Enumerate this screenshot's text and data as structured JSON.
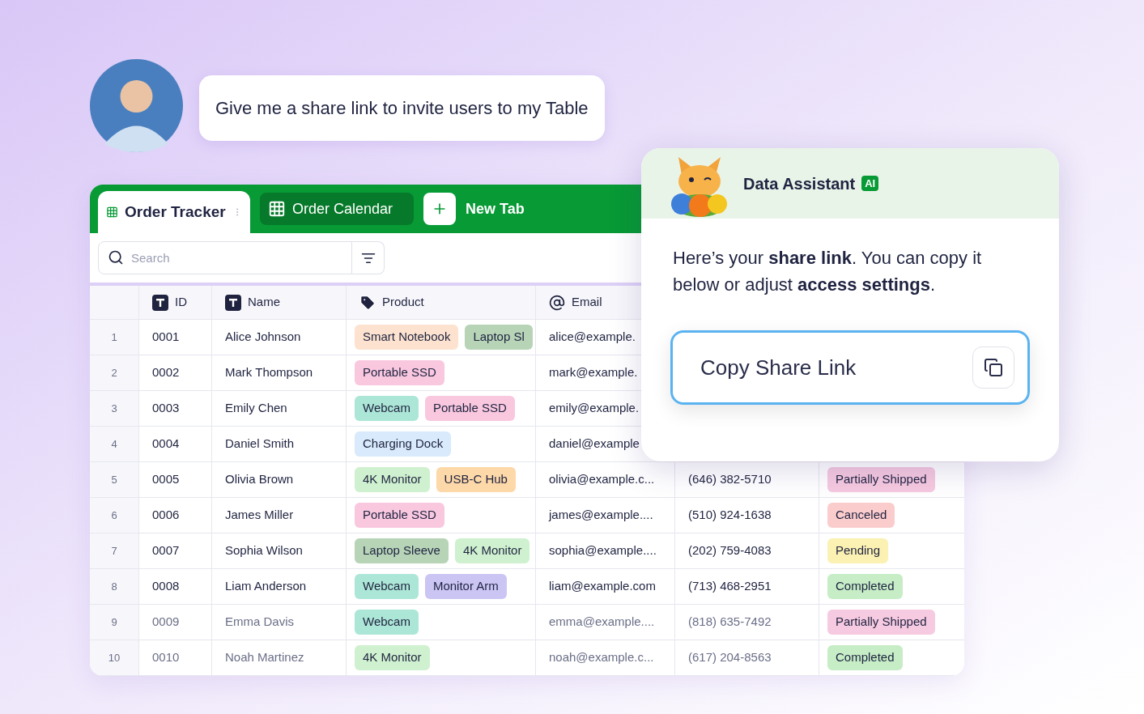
{
  "chat": {
    "message": "Give me a share link to invite users to my Table"
  },
  "tabs": [
    {
      "label": "Order Tracker",
      "selected": true
    },
    {
      "label": "Order Calendar",
      "selected": false
    }
  ],
  "new_tab": {
    "label": "New Tab"
  },
  "search": {
    "placeholder": "Search"
  },
  "table": {
    "columns": [
      {
        "label": "ID",
        "kind": "text"
      },
      {
        "label": "Name",
        "kind": "text"
      },
      {
        "label": "Product",
        "kind": "tag"
      },
      {
        "label": "Email",
        "kind": "email"
      }
    ],
    "rows": [
      {
        "number": "1",
        "id": "0001",
        "name": "Alice Johnson",
        "products": [
          {
            "label": "Smart Notebook",
            "color": "#fde3cf"
          },
          {
            "label": "Laptop Sl",
            "color": "#b7d4b7"
          }
        ],
        "email": "alice@example."
      },
      {
        "number": "2",
        "id": "0002",
        "name": "Mark Thompson",
        "products": [
          {
            "label": "Portable SSD",
            "color": "#f9c8df"
          }
        ],
        "email": "mark@example."
      },
      {
        "number": "3",
        "id": "0003",
        "name": "Emily Chen",
        "products": [
          {
            "label": "Webcam",
            "color": "#ace6d6"
          },
          {
            "label": "Portable SSD",
            "color": "#f9c8df"
          }
        ],
        "email": "emily@example."
      },
      {
        "number": "4",
        "id": "0004",
        "name": "Daniel Smith",
        "products": [
          {
            "label": "Charging Dock",
            "color": "#d8eafb"
          }
        ],
        "email": "daniel@example"
      },
      {
        "number": "5",
        "id": "0005",
        "name": "Olivia Brown",
        "products": [
          {
            "label": "4K Monitor",
            "color": "#cff1cf"
          },
          {
            "label": "USB-C Hub",
            "color": "#fdd8a8"
          }
        ],
        "email": "olivia@example.c...",
        "phone": "(646) 382-5710",
        "status": {
          "label": "Partially Shipped",
          "color": "#f6cae0"
        }
      },
      {
        "number": "6",
        "id": "0006",
        "name": "James Miller",
        "products": [
          {
            "label": "Portable SSD",
            "color": "#f9c8df"
          }
        ],
        "email": "james@example....",
        "phone": "(510) 924-1638",
        "status": {
          "label": "Canceled",
          "color": "#fbcccc"
        }
      },
      {
        "number": "7",
        "id": "0007",
        "name": "Sophia Wilson",
        "products": [
          {
            "label": "Laptop Sleeve",
            "color": "#b7d4b7"
          },
          {
            "label": "4K Monitor",
            "color": "#cff1cf"
          }
        ],
        "email": "sophia@example....",
        "phone": "(202) 759-4083",
        "status": {
          "label": "Pending",
          "color": "#fbf1b3"
        }
      },
      {
        "number": "8",
        "id": "0008",
        "name": "Liam Anderson",
        "products": [
          {
            "label": "Webcam",
            "color": "#ace6d6"
          },
          {
            "label": "Monitor Arm",
            "color": "#cbc5f4"
          }
        ],
        "email": "liam@example.com",
        "phone": "(713) 468-2951",
        "status": {
          "label": "Completed",
          "color": "#c6edc6"
        }
      },
      {
        "number": "9",
        "id": "0009",
        "name": "Emma Davis",
        "products": [
          {
            "label": "Webcam",
            "color": "#ace6d6"
          }
        ],
        "email": "emma@example....",
        "phone": "(818) 635-7492",
        "status": {
          "label": "Partially Shipped",
          "color": "#f6cae0"
        }
      },
      {
        "number": "10",
        "id": "0010",
        "name": "Noah Martinez",
        "products": [
          {
            "label": "4K Monitor",
            "color": "#cff1cf"
          }
        ],
        "email": "noah@example.c...",
        "phone": "(617) 204-8563",
        "status": {
          "label": "Completed",
          "color": "#c6edc6"
        }
      }
    ]
  },
  "assistant": {
    "title": "Data Assistant",
    "badge": "AI",
    "message": "Here’s your **share link**. You can copy it below or adjust **access settings**.",
    "link_label": "Copy Share Link"
  }
}
